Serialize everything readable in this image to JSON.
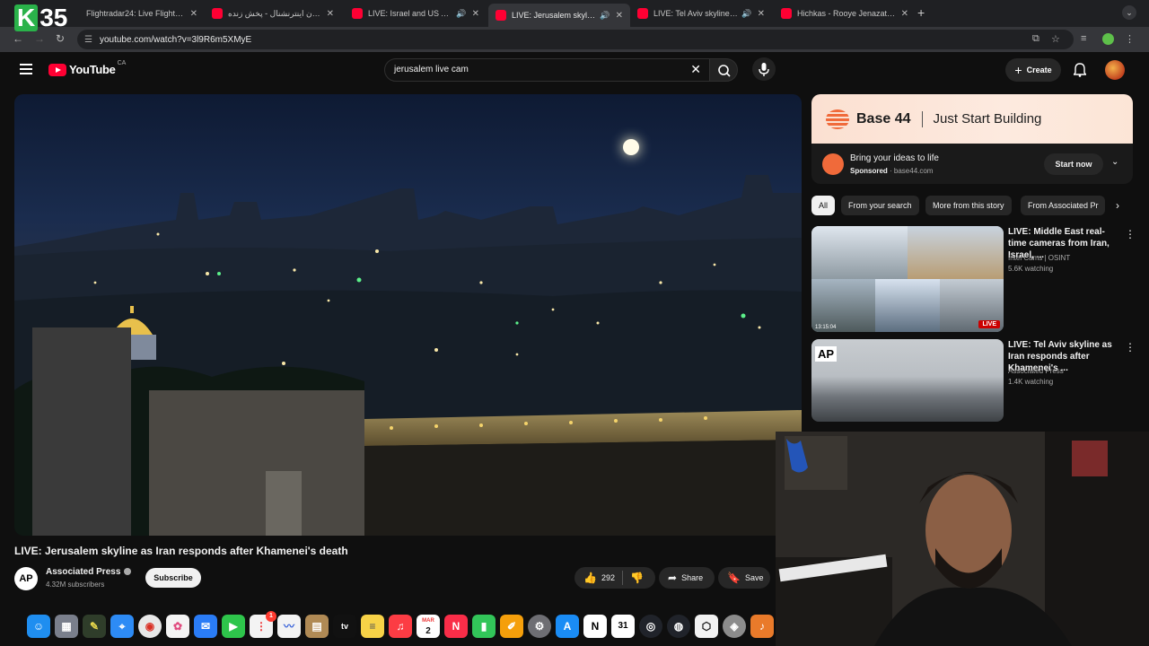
{
  "overlay": {
    "logo_prefix": "K",
    "logo_number": "35"
  },
  "browser": {
    "tabs": [
      {
        "title": "Flightradar24: Live Flight Tra",
        "muted": false,
        "active": false
      },
      {
        "title": "ایران اینترنشنال - پخش زنده – ube",
        "muted": false,
        "active": false
      },
      {
        "title": "LIVE: Israel and US Attack",
        "muted": true,
        "active": false
      },
      {
        "title": "LIVE: Jerusalem skyline a",
        "muted": true,
        "active": true
      },
      {
        "title": "LIVE: Tel Aviv skyline as I",
        "muted": true,
        "active": false
      },
      {
        "title": "Hichkas - Rooye Jenazat Min",
        "muted": false,
        "active": false
      }
    ],
    "url": "youtube.com/watch?v=3l9R6m5XMyE"
  },
  "youtube": {
    "logo_text": "YouTube",
    "region": "CA",
    "search_query": "jerusalem live cam",
    "create_label": "Create",
    "video": {
      "title": "LIVE: Jerusalem skyline as Iran responds after Khamenei's death",
      "channel_initials": "AP",
      "channel": "Associated Press",
      "subscribers": "4.32M subscribers",
      "subscribe_label": "Subscribe",
      "likes": "292",
      "share_label": "Share",
      "save_label": "Save"
    },
    "ad": {
      "brand": "Base 44",
      "tagline": "Just Start Building",
      "headline": "Bring your ideas to life",
      "sponsored": "Sponsored",
      "domain": "base44.com",
      "cta": "Start now"
    },
    "chips": [
      "All",
      "From your search",
      "More from this story",
      "From Associated Pr"
    ],
    "recommendations": [
      {
        "title": "LIVE: Middle East real-time cameras from Iran, Israel, ...",
        "channel": "Intel Cams | OSINT",
        "watching": "5.6K watching",
        "badge": "LIVE",
        "thumb_time": "13:15:04"
      },
      {
        "title": "LIVE: Tel Aviv skyline as Iran responds after Khamenei's ...",
        "channel": "Associated Press",
        "watching": "1.4K watching",
        "thumb_logo": "AP"
      }
    ]
  },
  "dock": {
    "calendar_month": "MAR",
    "calendar_day": "2",
    "date_day": "31",
    "tv_label": "tv",
    "notion_label": "N",
    "badge_count": "1"
  },
  "colors": {
    "youtube_red": "#ff0033",
    "ad_orange": "#f06a3a",
    "live_red": "#cc0000"
  }
}
